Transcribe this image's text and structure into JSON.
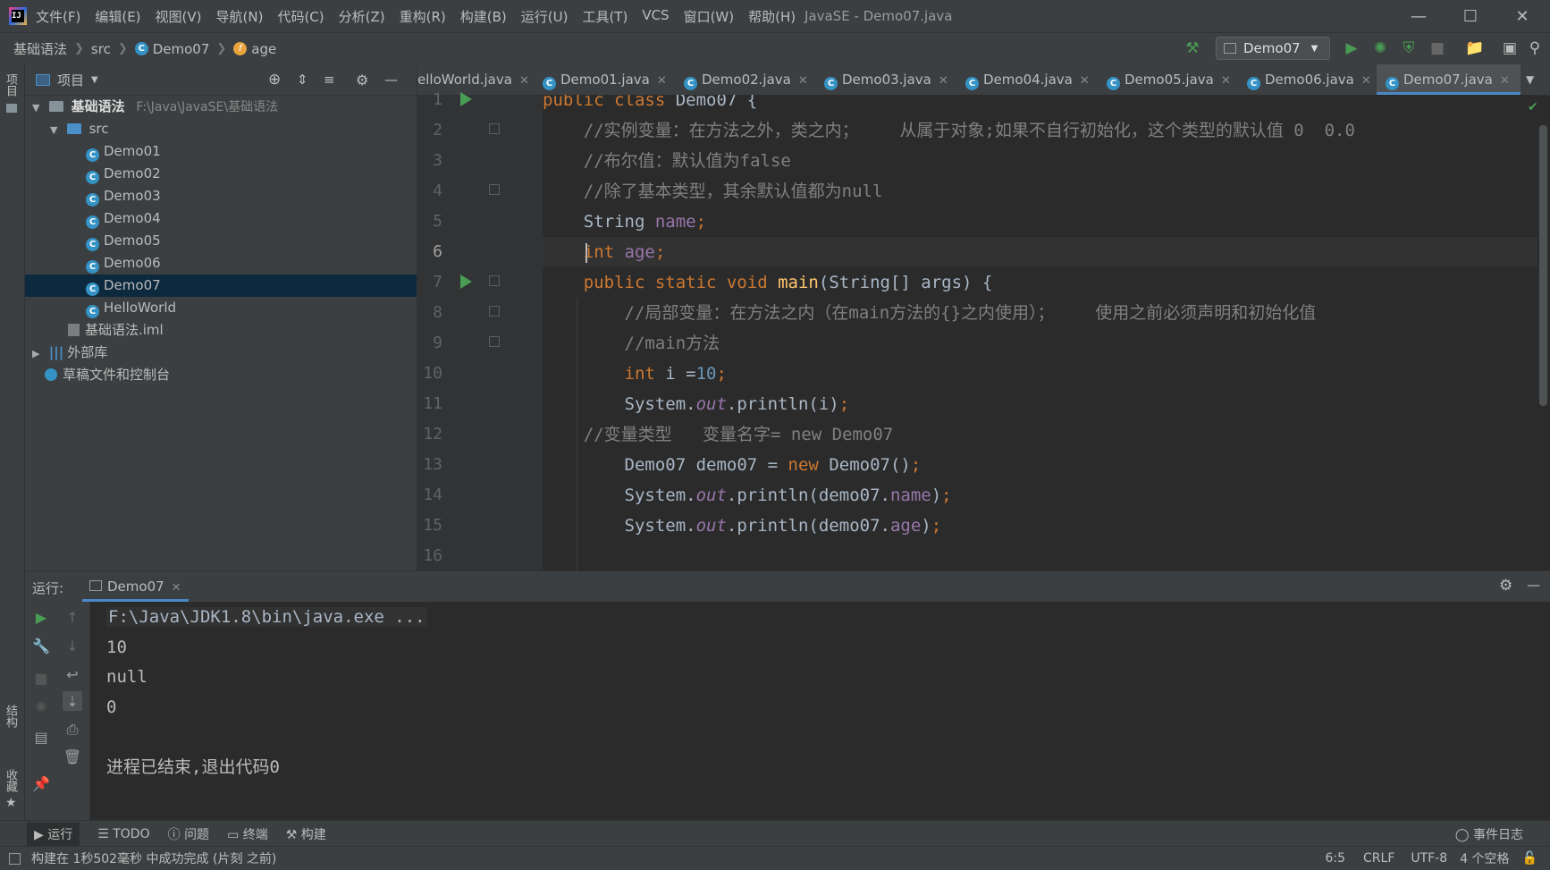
{
  "window": {
    "title": "JavaSE - Demo07.java",
    "logo_text": "IJ",
    "menu": [
      "文件(F)",
      "编辑(E)",
      "视图(V)",
      "导航(N)",
      "代码(C)",
      "分析(Z)",
      "重构(R)",
      "构建(B)",
      "运行(U)",
      "工具(T)",
      "VCS",
      "窗口(W)",
      "帮助(H)"
    ]
  },
  "breadcrumb": {
    "project": "基础语法",
    "src": "src",
    "class": "Demo07",
    "field": "age"
  },
  "run_config": {
    "selected": "Demo07"
  },
  "left_stripe": {
    "project_tab": "项目",
    "structure_tab": "结构",
    "favorites_tab": "收藏"
  },
  "project_panel": {
    "header_label": "项目",
    "tree": [
      {
        "label": "基础语法",
        "path": "F:\\Java\\JavaSE\\基础语法"
      },
      {
        "label": "src"
      },
      {
        "label": "Demo01"
      },
      {
        "label": "Demo02"
      },
      {
        "label": "Demo03"
      },
      {
        "label": "Demo04"
      },
      {
        "label": "Demo05"
      },
      {
        "label": "Demo06"
      },
      {
        "label": "Demo07"
      },
      {
        "label": "HelloWorld"
      },
      {
        "label": "基础语法.iml"
      },
      {
        "label": "外部库"
      },
      {
        "label": "草稿文件和控制台"
      }
    ]
  },
  "tabs": [
    "elloWorld.java",
    "Demo01.java",
    "Demo02.java",
    "Demo03.java",
    "Demo04.java",
    "Demo05.java",
    "Demo06.java",
    "Demo07.java"
  ],
  "editor": {
    "line_numbers": [
      "1",
      "2",
      "3",
      "4",
      "5",
      "6",
      "7",
      "8",
      "9",
      "10",
      "11",
      "12",
      "13",
      "14",
      "15",
      "16"
    ],
    "lines": [
      [
        [
          "kw",
          "public class "
        ],
        [
          "",
          "Demo07 {"
        ]
      ],
      [
        [
          "",
          "    "
        ],
        [
          "cm",
          "//实例变量：在方法之外，类之内；    从属于对象;如果不自行初始化，这个类型的默认值 0  0.0"
        ]
      ],
      [
        [
          "",
          "    "
        ],
        [
          "cm",
          "//布尔值：默认值为false"
        ]
      ],
      [
        [
          "",
          "    "
        ],
        [
          "cm",
          "//除了基本类型，其余默认值都为null"
        ]
      ],
      [
        [
          "",
          "    String "
        ],
        [
          "fld",
          "name"
        ],
        [
          "kw",
          ";"
        ]
      ],
      [
        [
          "",
          "    "
        ],
        [
          "kw",
          "int "
        ],
        [
          "fld",
          "age"
        ],
        [
          "kw",
          ";"
        ]
      ],
      [
        [
          "",
          "    "
        ],
        [
          "kw",
          "public static void "
        ],
        [
          "fn",
          "main"
        ],
        [
          "",
          "(String[] args) {"
        ]
      ],
      [
        [
          "",
          "        "
        ],
        [
          "cm",
          "//局部变量：在方法之内（在main方法的{}之内使用）；    使用之前必须声明和初始化值"
        ]
      ],
      [
        [
          "",
          "        "
        ],
        [
          "cm",
          "//main方法"
        ]
      ],
      [
        [
          "",
          "        "
        ],
        [
          "kw",
          "int "
        ],
        [
          "",
          "i ="
        ],
        [
          "num",
          "10"
        ],
        [
          "kw",
          ";"
        ]
      ],
      [
        [
          "",
          "        System."
        ],
        [
          "st",
          "out"
        ],
        [
          "",
          ".println(i)"
        ],
        [
          "kw",
          ";"
        ]
      ],
      [
        [
          "",
          "    "
        ],
        [
          "cm",
          "//变量类型   变量名字= new Demo07"
        ]
      ],
      [
        [
          "",
          "        Demo07 demo07 = "
        ],
        [
          "kw",
          "new "
        ],
        [
          "",
          "Demo07()"
        ],
        [
          "kw",
          ";"
        ]
      ],
      [
        [
          "",
          "        System."
        ],
        [
          "st",
          "out"
        ],
        [
          "",
          ".println(demo07."
        ],
        [
          "fld",
          "name"
        ],
        [
          "",
          ")"
        ],
        [
          "kw",
          ";"
        ]
      ],
      [
        [
          "",
          "        System."
        ],
        [
          "st",
          "out"
        ],
        [
          "",
          ".println(demo07."
        ],
        [
          "fld",
          "age"
        ],
        [
          "",
          ")"
        ],
        [
          "kw",
          ";"
        ]
      ],
      [
        [
          "",
          ""
        ]
      ]
    ]
  },
  "run_panel": {
    "label": "运行:",
    "tab": "Demo07",
    "console": [
      "F:\\Java\\JDK1.8\\bin\\java.exe ...",
      "10",
      "null",
      "0",
      "",
      "进程已结束,退出代码0"
    ]
  },
  "bottom_tabs": {
    "run": "运行",
    "todo": "TODO",
    "problems": "问题",
    "terminal": "终端",
    "build": "构建",
    "event_log": "事件日志"
  },
  "status": {
    "message": "构建在 1秒502毫秒 中成功完成 (片刻 之前)",
    "position": "6:5",
    "line_sep": "CRLF",
    "encoding": "UTF-8",
    "indent": "4 个空格"
  },
  "colors": {
    "accent": "#4a88c7",
    "run_green": "#499c54",
    "selection": "#0d293e"
  }
}
